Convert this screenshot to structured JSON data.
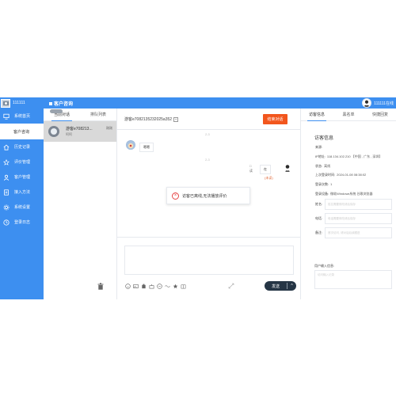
{
  "app": {
    "brand": "111111",
    "page_title": "客户咨询"
  },
  "user": {
    "name": "111111在线"
  },
  "sidebar": {
    "items": [
      {
        "label": "系统首页",
        "icon": "monitor-icon"
      },
      {
        "label": "客户咨询",
        "icon": ""
      },
      {
        "label": "历史记录",
        "icon": "home-icon"
      },
      {
        "label": "评价管理",
        "icon": "star-icon"
      },
      {
        "label": "客户管理",
        "icon": "user-icon"
      },
      {
        "label": "接入方法",
        "icon": "document-icon"
      },
      {
        "label": "系统设置",
        "icon": "gear-icon"
      },
      {
        "label": "登录日志",
        "icon": "clock-icon"
      }
    ]
  },
  "conversations": {
    "tabs": [
      "当前对话",
      "排队列表"
    ],
    "items": [
      {
        "name": "游客e708213...",
        "time": "刚刚",
        "last": "呵呵"
      }
    ]
  },
  "chat": {
    "header": "游客e7082135232025a352",
    "end_button": "结束对话",
    "messages": [
      {
        "time": "2-3",
        "text": "嗯嗯"
      },
      {
        "time": "2-3",
        "text": "在",
        "status": "(未读)"
      }
    ],
    "notice": "访客已离线,无法播放评价",
    "send_label": "发送",
    "toolbar": [
      "smile-icon",
      "image-icon",
      "file-icon",
      "link-icon",
      "emoji-icon",
      "wave-icon",
      "star-icon",
      "book-icon"
    ]
  },
  "right": {
    "tabs": [
      "访客信息",
      "黑名单",
      "快捷回复"
    ],
    "section_title": "访客信息",
    "fields": [
      {
        "label": "来源:",
        "value": ""
      },
      {
        "label": "IP地址:",
        "value": "118.134.102.210 【中国 , 广东 , 深圳】"
      },
      {
        "label": "状态:",
        "value": "离线"
      },
      {
        "label": "上次登录时间:",
        "value": "2024-01-08 08:38:02"
      },
      {
        "label": "登录次数:",
        "value": "1"
      },
      {
        "label": "登录设备:",
        "value": "微软Windows系统 谷歌浏览器"
      }
    ],
    "inputs": [
      {
        "label": "姓名:",
        "placeholder": "姓名需要修改请后保存"
      },
      {
        "label": "电话:",
        "placeholder": "电话需要修改请后保存"
      },
      {
        "label": "备注:",
        "placeholder": "首次访问, 请对话后续跟进"
      }
    ],
    "input_title": "用户输入信息:",
    "textarea_placeholder": "访问输入记录"
  },
  "colors": {
    "primary": "#3d8ff0",
    "danger": "#f2561d",
    "send": "#253545"
  }
}
